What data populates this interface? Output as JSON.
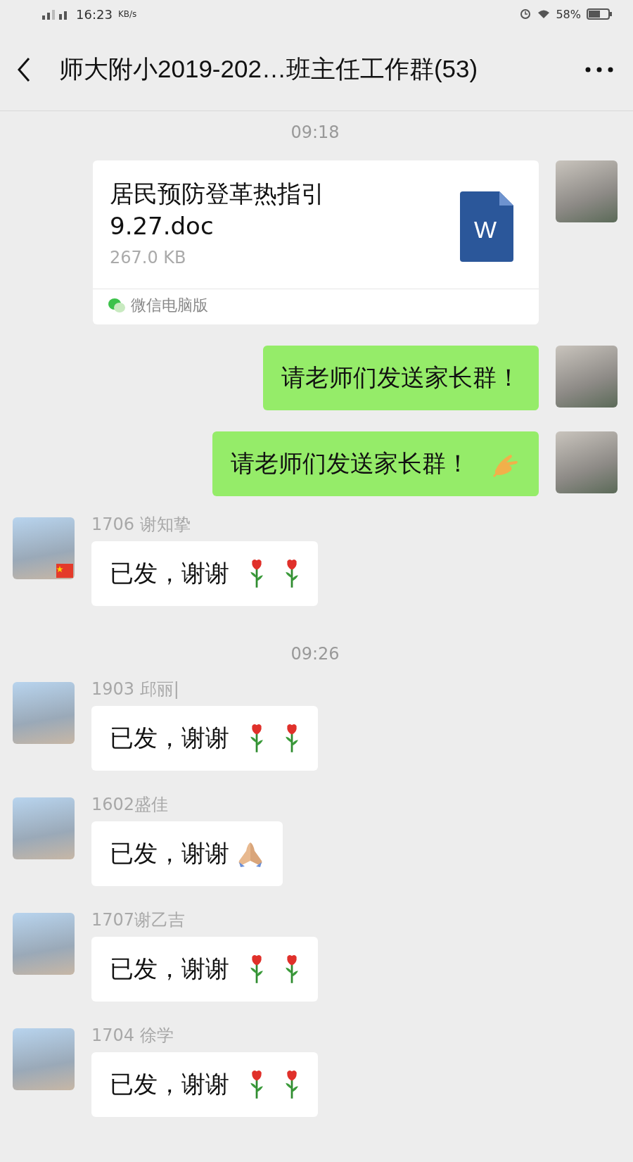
{
  "status_bar": {
    "time": "16:23",
    "speed_unit": "KB/s",
    "battery": "58%"
  },
  "nav": {
    "title": "师大附小2019-202…班主任工作群(53)"
  },
  "messages": [
    {
      "kind": "time",
      "text": "09:18"
    },
    {
      "kind": "file",
      "outgoing": true,
      "file_name": "居民预防登革热指引9.27.doc",
      "file_size": "267.0 KB",
      "file_icon_letter": "W",
      "source": "微信电脑版"
    },
    {
      "kind": "text",
      "outgoing": true,
      "text": "请老师们发送家长群！"
    },
    {
      "kind": "text",
      "outgoing": true,
      "text": "请老师们发送家长群！",
      "emojis": [
        {
          "kind": "ok"
        }
      ]
    },
    {
      "kind": "text",
      "outgoing": false,
      "sender": "1706 谢知挚",
      "flag": true,
      "text": "已发，谢谢",
      "emojis": [
        {
          "kind": "rose"
        },
        {
          "kind": "rose"
        }
      ]
    },
    {
      "kind": "time",
      "text": "09:26"
    },
    {
      "kind": "text",
      "outgoing": false,
      "sender": "1903 邱丽|",
      "flag": false,
      "text": "已发，谢谢",
      "emojis": [
        {
          "kind": "rose"
        },
        {
          "kind": "rose"
        }
      ]
    },
    {
      "kind": "text",
      "outgoing": false,
      "sender": "1602盛佳",
      "flag": false,
      "text": "已发，谢谢",
      "emojis": [
        {
          "kind": "pray"
        }
      ]
    },
    {
      "kind": "text",
      "outgoing": false,
      "sender": "1707谢乙吉",
      "flag": false,
      "text": "已发，谢谢",
      "emojis": [
        {
          "kind": "rose"
        },
        {
          "kind": "rose"
        }
      ]
    },
    {
      "kind": "text",
      "outgoing": false,
      "sender": "1704 徐学",
      "flag": false,
      "text": "已发，谢谢",
      "emojis": [
        {
          "kind": "rose"
        },
        {
          "kind": "rose"
        }
      ]
    }
  ]
}
